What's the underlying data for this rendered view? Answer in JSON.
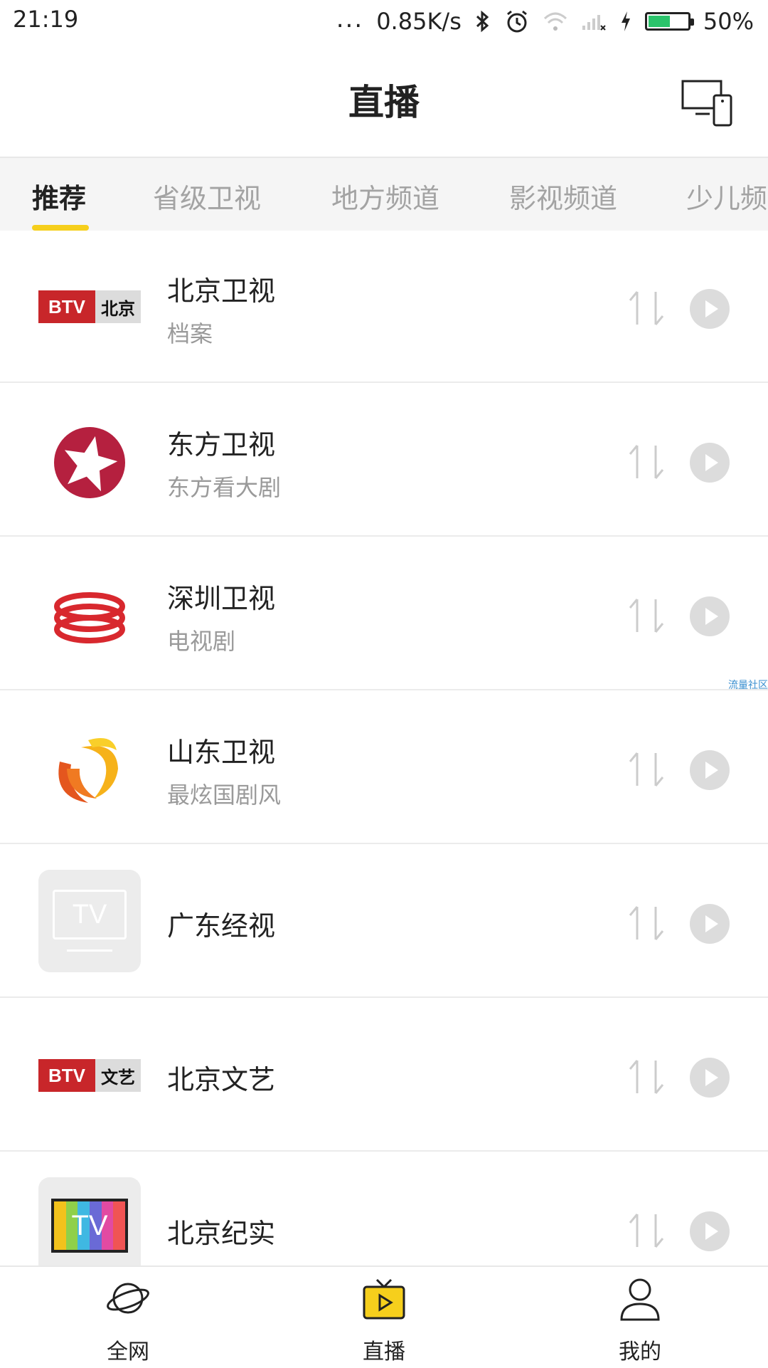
{
  "status_bar": {
    "time": "21:19",
    "dots": "...",
    "net_speed": "0.85K/s",
    "battery_percent": "50%"
  },
  "header": {
    "title": "直播",
    "cast_icon": "cast-screen-icon"
  },
  "tabs": [
    {
      "label": "推荐",
      "active": true
    },
    {
      "label": "省级卫视",
      "active": false
    },
    {
      "label": "地方频道",
      "active": false
    },
    {
      "label": "影视频道",
      "active": false
    },
    {
      "label": "少儿频",
      "active": false
    }
  ],
  "channels": [
    {
      "name": "北京卫视",
      "program": "档案",
      "logo": "btv-beijing-logo",
      "logo_text": [
        "BTV",
        "北京"
      ]
    },
    {
      "name": "东方卫视",
      "program": "东方看大剧",
      "logo": "dragon-tv-star-logo"
    },
    {
      "name": "深圳卫视",
      "program": "电视剧",
      "logo": "shenzhen-tv-logo"
    },
    {
      "name": "山东卫视",
      "program": "最炫国剧风",
      "logo": "shandong-tv-logo"
    },
    {
      "name": "广东经视",
      "program": "",
      "logo": "tv-placeholder-logo",
      "logo_text": [
        "TV"
      ]
    },
    {
      "name": "北京文艺",
      "program": "",
      "logo": "btv-wenyi-logo",
      "logo_text": [
        "BTV",
        "文艺"
      ]
    },
    {
      "name": "北京纪实",
      "program": "",
      "logo": "color-tv-logo",
      "logo_text": [
        "TV"
      ]
    }
  ],
  "watermark": "流量社区",
  "bottom_nav": [
    {
      "label": "全网",
      "icon": "planet-icon"
    },
    {
      "label": "直播",
      "icon": "live-tv-icon",
      "active": true
    },
    {
      "label": "我的",
      "icon": "user-icon"
    }
  ],
  "colors": {
    "accent_yellow": "#f6cf1c",
    "btv_red": "#c8262a",
    "battery_green": "#2bc36b"
  }
}
